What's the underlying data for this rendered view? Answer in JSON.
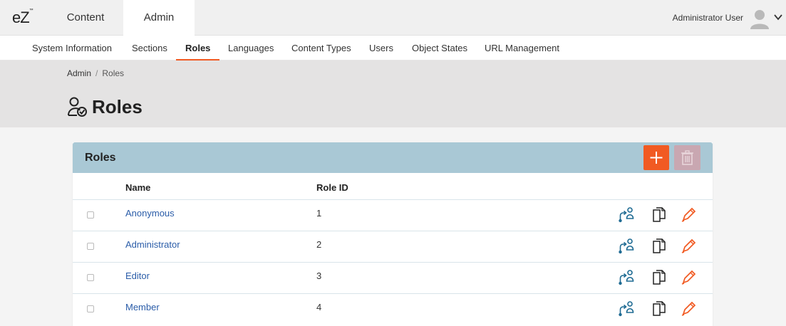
{
  "logo": "eZ",
  "top_tabs": [
    {
      "label": "Content"
    },
    {
      "label": "Admin"
    }
  ],
  "user": {
    "name": "Administrator User"
  },
  "subnav": [
    {
      "label": "System Information"
    },
    {
      "label": "Sections"
    },
    {
      "label": "Roles"
    },
    {
      "label": "Languages"
    },
    {
      "label": "Content Types"
    },
    {
      "label": "Users"
    },
    {
      "label": "Object States"
    },
    {
      "label": "URL Management"
    }
  ],
  "active_subnav": "Roles",
  "breadcrumb": {
    "parent": "Admin",
    "separator": "/",
    "current": "Roles"
  },
  "page_title": "Roles",
  "panel": {
    "title": "Roles",
    "columns": {
      "name": "Name",
      "role_id": "Role ID"
    },
    "rows": [
      {
        "name": "Anonymous",
        "id": "1"
      },
      {
        "name": "Administrator",
        "id": "2"
      },
      {
        "name": "Editor",
        "id": "3"
      },
      {
        "name": "Member",
        "id": "4"
      }
    ]
  },
  "colors": {
    "accent": "#f15a22",
    "panel_header": "#a9c8d5",
    "link": "#2a5ca8",
    "assign_icon": "#1f6b93",
    "delete_disabled": "#c9a7b1"
  },
  "icons": {
    "title": "roles-icon",
    "add": "plus-icon",
    "delete": "trash-icon",
    "assign": "assign-user-icon",
    "copy": "copy-icon",
    "edit": "pencil-icon",
    "avatar": "user-avatar-icon",
    "menu": "chevron-down-icon"
  }
}
